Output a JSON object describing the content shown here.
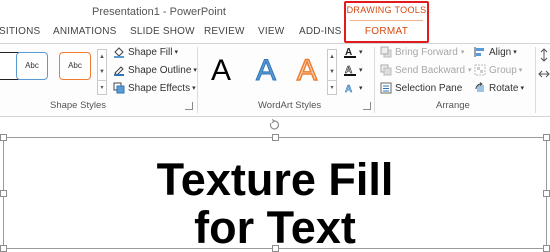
{
  "app": {
    "title": "Presentation1 - PowerPoint"
  },
  "tabs": [
    "SITIONS",
    "ANIMATIONS",
    "SLIDE SHOW",
    "REVIEW",
    "VIEW",
    "ADD-INS"
  ],
  "contextual": {
    "group": "DRAWING TOOLS",
    "tab": "FORMAT",
    "highlight_color": "#e11b1b",
    "accent": "#d64a10"
  },
  "shape_styles": {
    "label": "Shape Styles",
    "swatches": [
      "Abc",
      "Abc"
    ],
    "commands": {
      "fill": "Shape Fill",
      "outline": "Shape Outline",
      "effects": "Shape Effects"
    }
  },
  "wordart_styles": {
    "label": "WordArt Styles",
    "samples": [
      "A",
      "A",
      "A"
    ]
  },
  "arrange": {
    "label": "Arrange",
    "commands": {
      "bring_forward": "Bring Forward",
      "send_backward": "Send Backward",
      "selection_pane": "Selection Pane",
      "align": "Align",
      "group": "Group",
      "rotate": "Rotate"
    }
  },
  "slide": {
    "text_line1": "Texture Fill",
    "text_line2": "for Text"
  }
}
